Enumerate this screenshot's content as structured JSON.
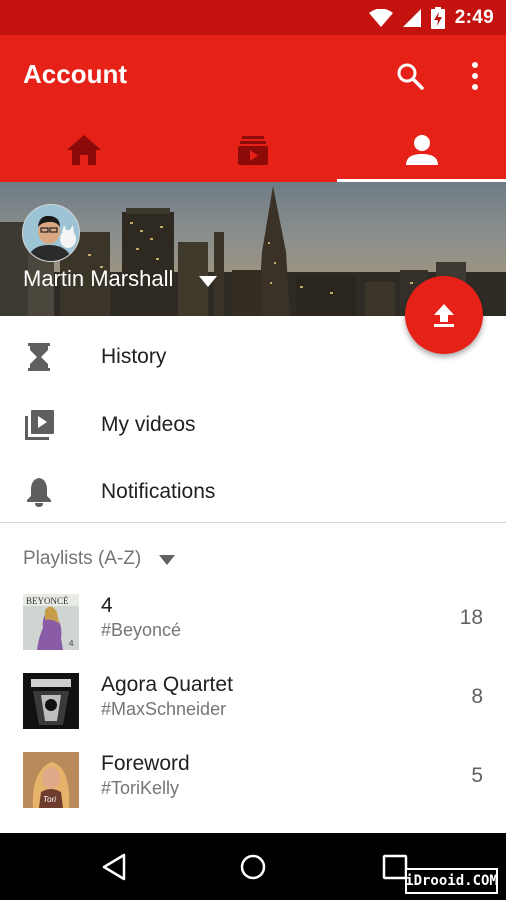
{
  "status_bar": {
    "time": "2:49",
    "icons": [
      "wifi-icon",
      "signal-icon",
      "battery-charging-icon"
    ]
  },
  "app_bar": {
    "title": "Account",
    "actions": [
      "search-icon",
      "more-vert-icon"
    ],
    "tabs": [
      {
        "icon": "home-icon",
        "selected": false
      },
      {
        "icon": "subscriptions-icon",
        "selected": false
      },
      {
        "icon": "account-icon",
        "selected": true
      }
    ]
  },
  "profile": {
    "name": "Martin Marshall"
  },
  "fab": {
    "icon": "upload-icon"
  },
  "menu": [
    {
      "icon": "hourglass-icon",
      "label": "History"
    },
    {
      "icon": "my-videos-icon",
      "label": "My videos"
    },
    {
      "icon": "bell-icon",
      "label": "Notifications"
    }
  ],
  "playlists": {
    "header": "Playlists (A-Z)",
    "items": [
      {
        "title": "4",
        "subtitle": "#Beyoncé",
        "count": "18",
        "thumb_text": "BEYONCÉ"
      },
      {
        "title": "Agora Quartet",
        "subtitle": "#MaxSchneider",
        "count": "8"
      },
      {
        "title": "Foreword",
        "subtitle": "#ToriKelly",
        "count": "5"
      }
    ]
  },
  "nav_bar": [
    "back-icon",
    "home-circle-icon",
    "recents-icon"
  ],
  "watermark": "iDrooid.COM",
  "colors": {
    "primary": "#e62117",
    "status_bar": "#c4120f",
    "secondary_text": "#757575"
  }
}
